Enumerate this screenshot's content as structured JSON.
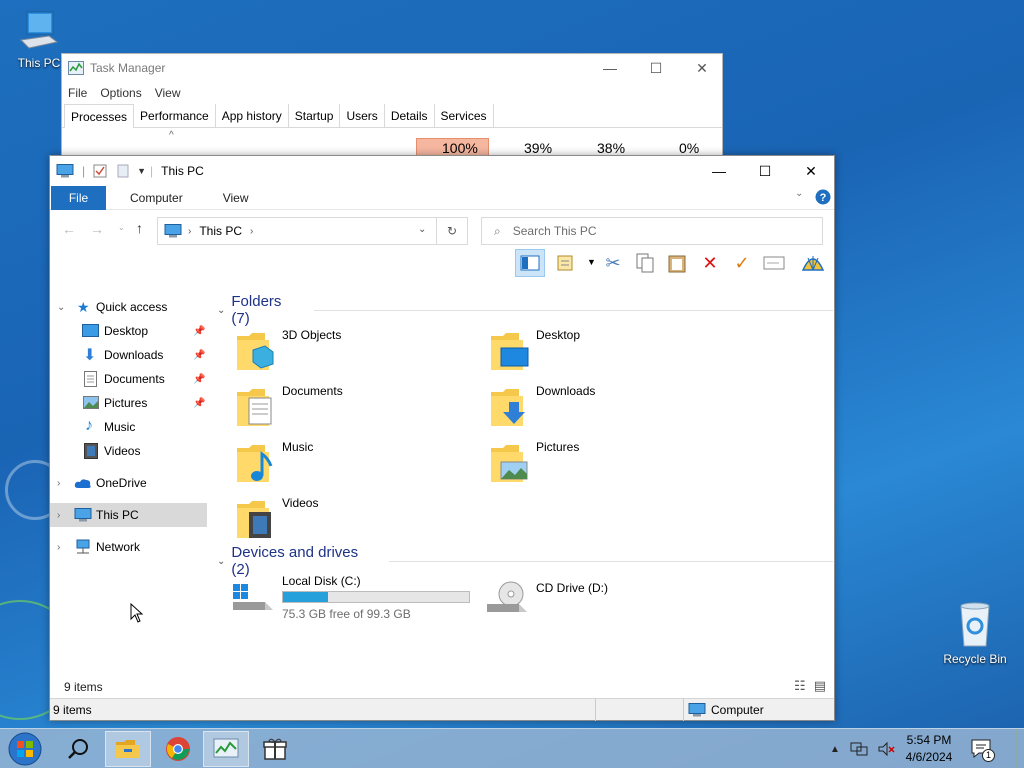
{
  "desktop": {
    "icons": [
      {
        "label": "This PC"
      },
      {
        "label": "Recycle Bin"
      }
    ]
  },
  "task_manager": {
    "title": "Task Manager",
    "menu": [
      "File",
      "Options",
      "View"
    ],
    "tabs": [
      "Processes",
      "Performance",
      "App history",
      "Startup",
      "Users",
      "Details",
      "Services"
    ],
    "active_tab": "Processes",
    "columns": [
      "100%",
      "39%",
      "38%",
      "0%"
    ],
    "colors": {
      "cpu_highlight": "#f6b7a0"
    }
  },
  "explorer": {
    "title": "This PC",
    "ribbon": {
      "file": "File",
      "tabs": [
        "Computer",
        "View"
      ]
    },
    "address": {
      "segments": [
        "This PC"
      ]
    },
    "search": {
      "placeholder": "Search This PC"
    },
    "sidebar": {
      "quick_access": "Quick access",
      "quick_items": [
        "Desktop",
        "Downloads",
        "Documents",
        "Pictures",
        "Music",
        "Videos"
      ],
      "onedrive": "OneDrive",
      "this_pc": "This PC",
      "network": "Network"
    },
    "folders_header": "Folders (7)",
    "folders": [
      "3D Objects",
      "Desktop",
      "Documents",
      "Downloads",
      "Music",
      "Pictures",
      "Videos"
    ],
    "devices_header": "Devices and drives (2)",
    "drives": [
      {
        "name": "Local Disk (C:)",
        "free_text": "75.3 GB free of 99.3 GB",
        "used_fraction": 0.24
      },
      {
        "name": "CD Drive (D:)"
      }
    ],
    "status_items": "9 items",
    "bottom": {
      "items": "9 items",
      "computer": "Computer"
    },
    "colors": {
      "accent": "#1f6fc1",
      "selected": "#d9d9d9",
      "progress": "#26a0da"
    }
  },
  "taskbar": {
    "clock": {
      "time": "5:54 PM",
      "date": "4/6/2024"
    },
    "notifications": "1"
  }
}
